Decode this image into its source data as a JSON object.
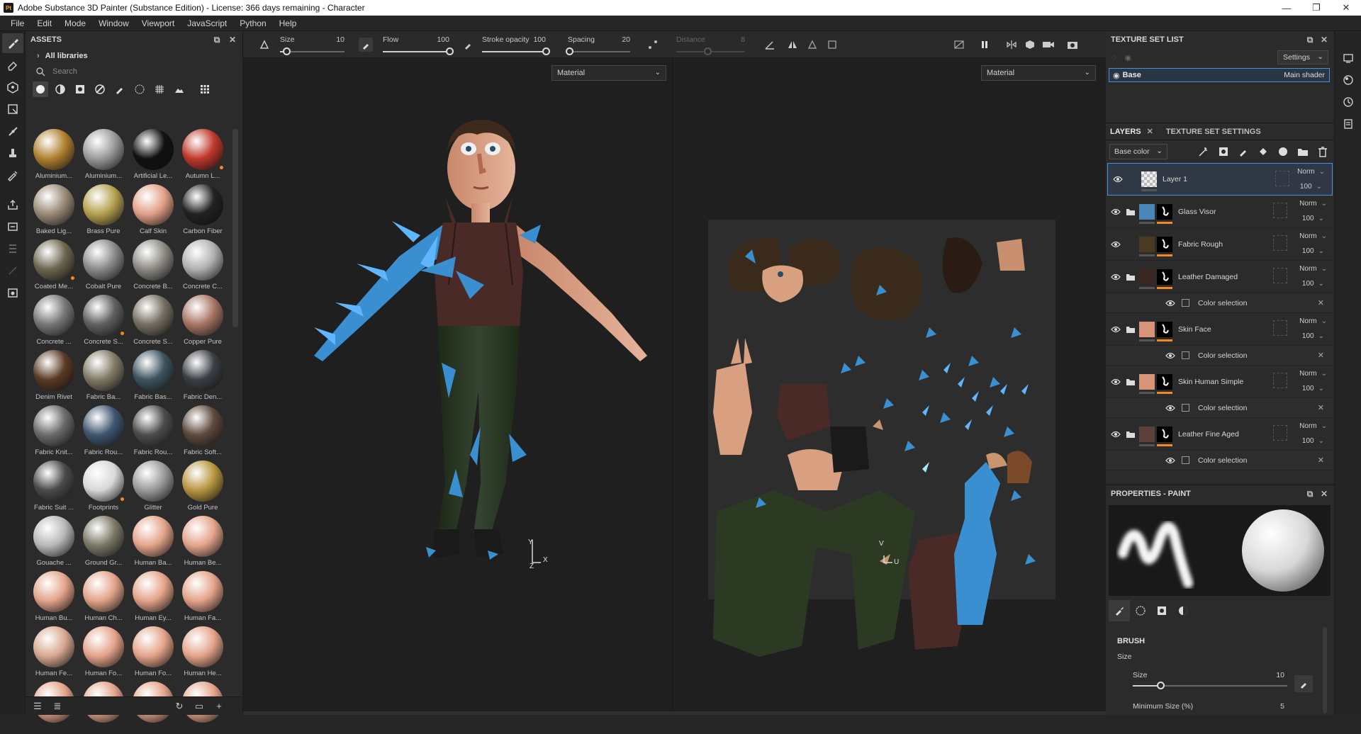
{
  "window": {
    "app_icon": "Pt",
    "title": "Adobe Substance 3D Painter (Substance Edition) - License: 366 days remaining - Character",
    "minimize": "—",
    "maximize": "❐",
    "close": "✕"
  },
  "menu": [
    "File",
    "Edit",
    "Mode",
    "Window",
    "Viewport",
    "JavaScript",
    "Python",
    "Help"
  ],
  "assets": {
    "title": "ASSETS",
    "libraries": "All libraries",
    "search_placeholder": "Search",
    "items": [
      {
        "label": "Aluminium...",
        "color": "#b08030"
      },
      {
        "label": "Aluminium...",
        "color": "#9a9a9a"
      },
      {
        "label": "Artificial Le...",
        "color": "#111111"
      },
      {
        "label": "Autumn L...",
        "color": "#c0392b"
      },
      {
        "label": "Baked Lig...",
        "color": "#9a8a78"
      },
      {
        "label": "Brass Pure",
        "color": "#b5a050"
      },
      {
        "label": "Calf Skin",
        "color": "#e2a088"
      },
      {
        "label": "Carbon Fiber",
        "color": "#222222"
      },
      {
        "label": "Coated Me...",
        "color": "#6e6650"
      },
      {
        "label": "Cobalt Pure",
        "color": "#8a8a8a"
      },
      {
        "label": "Concrete B...",
        "color": "#8d8a84"
      },
      {
        "label": "Concrete C...",
        "color": "#b0b0b0"
      },
      {
        "label": "Concrete ...",
        "color": "#777777"
      },
      {
        "label": "Concrete S...",
        "color": "#606060"
      },
      {
        "label": "Concrete S...",
        "color": "#756e62"
      },
      {
        "label": "Copper Pure",
        "color": "#a87565"
      },
      {
        "label": "Denim Rivet",
        "color": "#5a3a25"
      },
      {
        "label": "Fabric Ba...",
        "color": "#807a66"
      },
      {
        "label": "Fabric Bas...",
        "color": "#3e5360"
      },
      {
        "label": "Fabric Den...",
        "color": "#3b3f45"
      },
      {
        "label": "Fabric Knit...",
        "color": "#6a6a6a"
      },
      {
        "label": "Fabric Rou...",
        "color": "#3f5670"
      },
      {
        "label": "Fabric Rou...",
        "color": "#4d4d4d"
      },
      {
        "label": "Fabric Soft...",
        "color": "#5e4a3e"
      },
      {
        "label": "Fabric Suit ...",
        "color": "#4a4a4a"
      },
      {
        "label": "Footprints",
        "color": "#d8d8d8"
      },
      {
        "label": "Glitter",
        "color": "#9a9a9a"
      },
      {
        "label": "Gold Pure",
        "color": "#b89640"
      },
      {
        "label": "Gouache ...",
        "color": "#b8b8b8"
      },
      {
        "label": "Ground Gr...",
        "color": "#7c7868"
      },
      {
        "label": "Human Ba...",
        "color": "#e4a48a"
      },
      {
        "label": "Human Be...",
        "color": "#e4a48a"
      },
      {
        "label": "Human Bu...",
        "color": "#e4a48a"
      },
      {
        "label": "Human Ch...",
        "color": "#e4a48a"
      },
      {
        "label": "Human Ey...",
        "color": "#e4a48a"
      },
      {
        "label": "Human Fa...",
        "color": "#e4a48a"
      },
      {
        "label": "Human Fe...",
        "color": "#d8a890"
      },
      {
        "label": "Human Fo...",
        "color": "#e4a48a"
      },
      {
        "label": "Human Fo...",
        "color": "#e4a48a"
      },
      {
        "label": "Human He...",
        "color": "#e4a48a"
      },
      {
        "label": "",
        "color": "#e4a48a"
      },
      {
        "label": "",
        "color": "#e4a48a"
      },
      {
        "label": "",
        "color": "#e4a48a"
      },
      {
        "label": "",
        "color": "#e4a48a"
      }
    ]
  },
  "toolbar": {
    "size_label": "Size",
    "size_value": "10",
    "size_fraction": 0.1,
    "flow_label": "Flow",
    "flow_value": "100",
    "flow_fraction": 1.0,
    "stroke_opacity_label": "Stroke opacity",
    "stroke_opacity_value": "100",
    "stroke_opacity_fraction": 1.0,
    "spacing_label": "Spacing",
    "spacing_value": "20",
    "spacing_fraction": 0.02,
    "distance_label": "Distance",
    "distance_value": "8",
    "distance_fraction": 0.45
  },
  "viewport3d": {
    "mode": "Material",
    "axis_y": "Y",
    "axis_x": "X",
    "axis_z": "Z"
  },
  "viewport2d": {
    "mode": "Material",
    "axis_v": "V",
    "axis_u": "U"
  },
  "texture_set_list": {
    "title": "TEXTURE SET LIST",
    "settings": "Settings",
    "item_name": "Base",
    "item_shader": "Main shader"
  },
  "layers": {
    "tab_layers": "LAYERS",
    "tab_settings": "TEXTURE SET SETTINGS",
    "channel": "Base color",
    "rows": [
      {
        "kind": "layer",
        "name": "Layer 1",
        "blend": "Norm",
        "opacity": "100",
        "thumb": "#cccccc",
        "selected": true,
        "folder": false,
        "mask": false
      },
      {
        "kind": "layer",
        "name": "Glass Visor",
        "blend": "Norm",
        "opacity": "100",
        "thumb": "#4b86b8",
        "folder": true,
        "mask": true
      },
      {
        "kind": "layer",
        "name": "Fabric Rough",
        "blend": "Norm",
        "opacity": "100",
        "thumb": "#4a3a22",
        "folder": false,
        "mask": true
      },
      {
        "kind": "layer",
        "name": "Leather Damaged",
        "blend": "Norm",
        "opacity": "100",
        "thumb": "#3a2620",
        "folder": true,
        "mask": true
      },
      {
        "kind": "sub",
        "name": "Color selection"
      },
      {
        "kind": "layer",
        "name": "Skin Face",
        "blend": "Norm",
        "opacity": "100",
        "thumb": "#d89478",
        "folder": true,
        "mask": true
      },
      {
        "kind": "sub",
        "name": "Color selection"
      },
      {
        "kind": "layer",
        "name": "Skin Human Simple",
        "blend": "Norm",
        "opacity": "100",
        "thumb": "#d89478",
        "folder": true,
        "mask": true
      },
      {
        "kind": "sub",
        "name": "Color selection"
      },
      {
        "kind": "layer",
        "name": "Leather Fine Aged",
        "blend": "Norm",
        "opacity": "100",
        "thumb": "#5a4038",
        "folder": true,
        "mask": true
      },
      {
        "kind": "sub",
        "name": "Color selection"
      }
    ]
  },
  "properties": {
    "title": "PROPERTIES - PAINT",
    "brush_header": "BRUSH",
    "size_header": "Size",
    "size_label": "Size",
    "size_value": "10",
    "size_fraction": 0.18,
    "min_size_label": "Minimum Size (%)",
    "min_size_value": "5"
  }
}
